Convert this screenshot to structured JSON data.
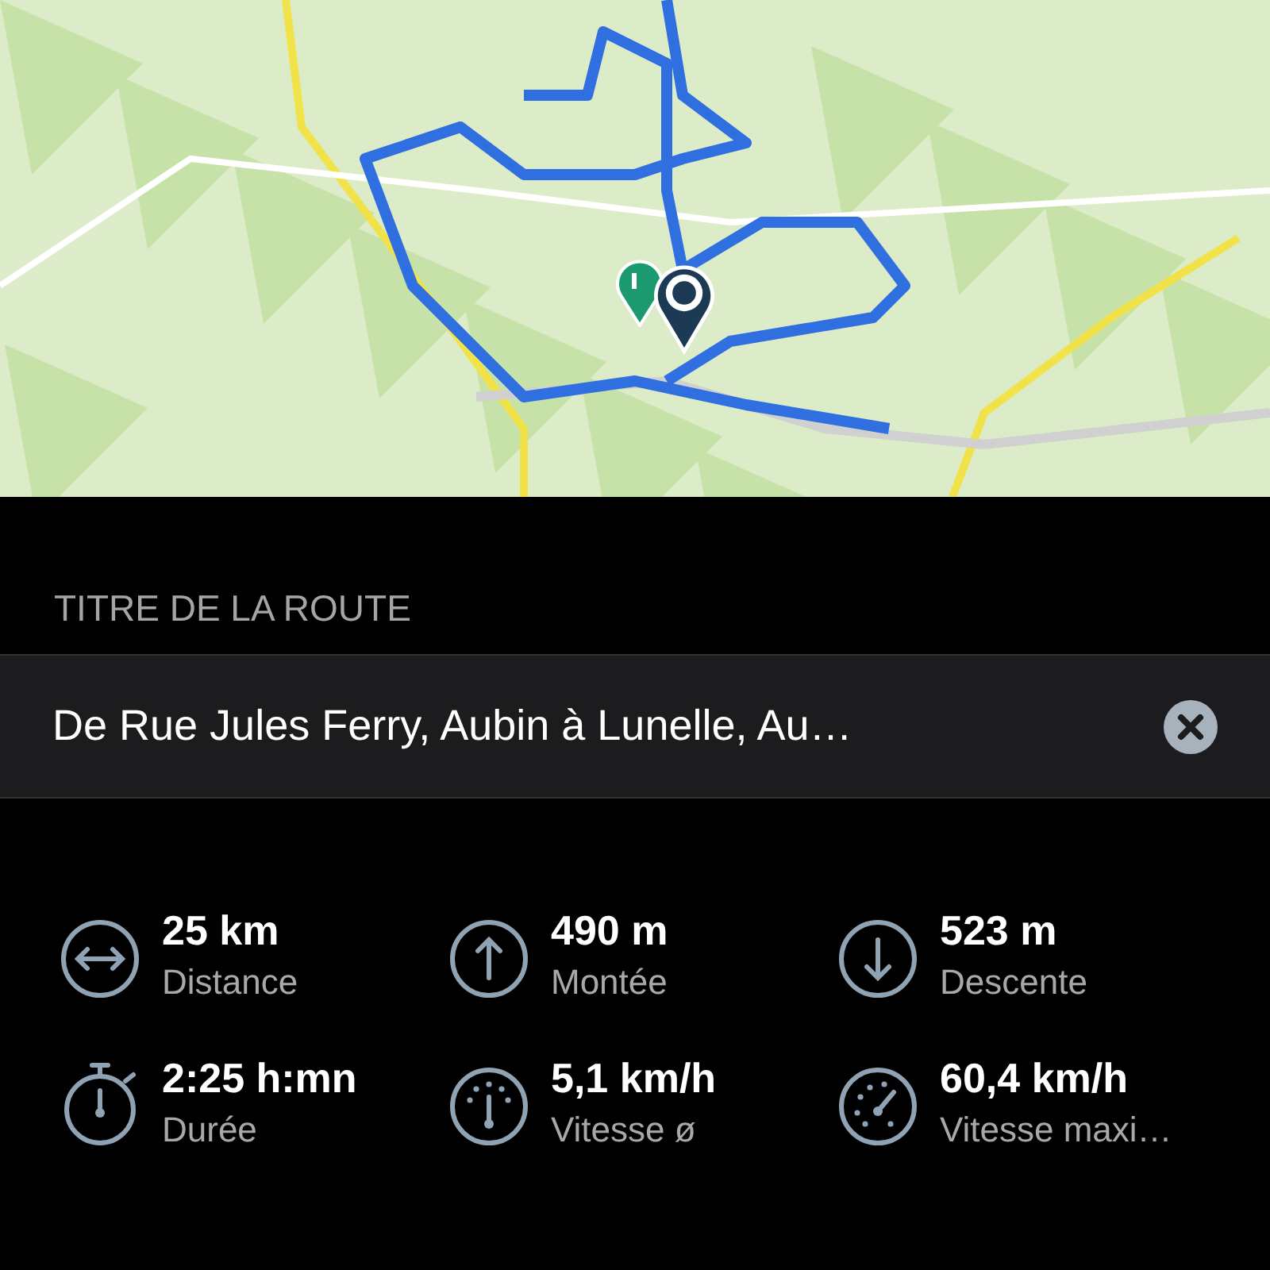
{
  "section_label": "TITRE DE LA ROUTE",
  "route_title": {
    "value": "De Rue Jules Ferry, Aubin à Lunelle, Au…"
  },
  "stats": [
    {
      "kind": "distance",
      "value": "25 km",
      "label": "Distance"
    },
    {
      "kind": "ascent",
      "value": "490 m",
      "label": "Montée"
    },
    {
      "kind": "descent",
      "value": "523 m",
      "label": "Descente"
    },
    {
      "kind": "duration",
      "value": "2:25 h:mn",
      "label": "Durée"
    },
    {
      "kind": "avg_speed",
      "value": "5,1 km/h",
      "label": "Vitesse ø"
    },
    {
      "kind": "max_speed",
      "value": "60,4 km/h",
      "label": "Vitesse maxi…"
    }
  ]
}
